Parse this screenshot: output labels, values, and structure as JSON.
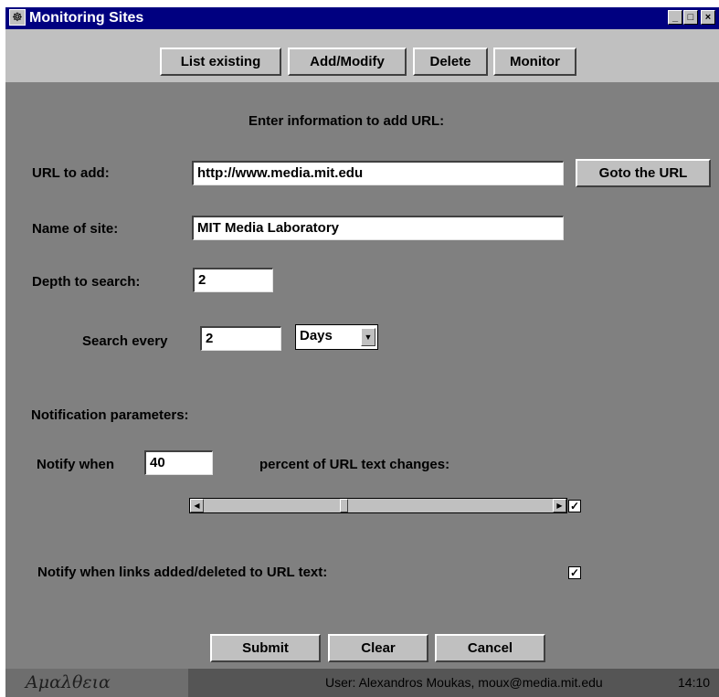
{
  "window": {
    "title": "Monitoring Sites",
    "icon": "app-icon",
    "controls": {
      "minimize": "minimize-icon",
      "maximize": "maximize-icon",
      "close": "close-icon"
    }
  },
  "toolbar": {
    "list_existing": "List existing",
    "add_modify": "Add/Modify",
    "delete": "Delete",
    "monitor": "Monitor"
  },
  "form": {
    "heading": "Enter information to add URL:",
    "url_label": "URL to add:",
    "url_value": "http://www.media.mit.edu",
    "goto_button": "Goto the URL",
    "name_label": "Name of site:",
    "name_value": "MIT Media Laboratory",
    "depth_label": "Depth to search:",
    "depth_value": "2",
    "search_every_label": "Search every",
    "search_every_value": "2",
    "search_unit": "Days"
  },
  "notification": {
    "heading": "Notification parameters:",
    "notify_when_label": "Notify when",
    "notify_percent_value": "40",
    "percent_label": "percent of URL text changes:",
    "slider_level": 0.4,
    "slider_checked": true,
    "links_label": "Notify when links added/deleted to URL text:",
    "links_checked": true
  },
  "actions": {
    "submit": "Submit",
    "clear": "Clear",
    "cancel": "Cancel"
  },
  "status": {
    "logo_text": "Αμαλθεια",
    "user": "User: Alexandros Moukas, moux@media.mit.edu",
    "time": "14:10"
  },
  "colors": {
    "titlebar": "#000080",
    "panel": "#808080",
    "button_face": "#c0c0c0",
    "statusbar": "#555555"
  }
}
